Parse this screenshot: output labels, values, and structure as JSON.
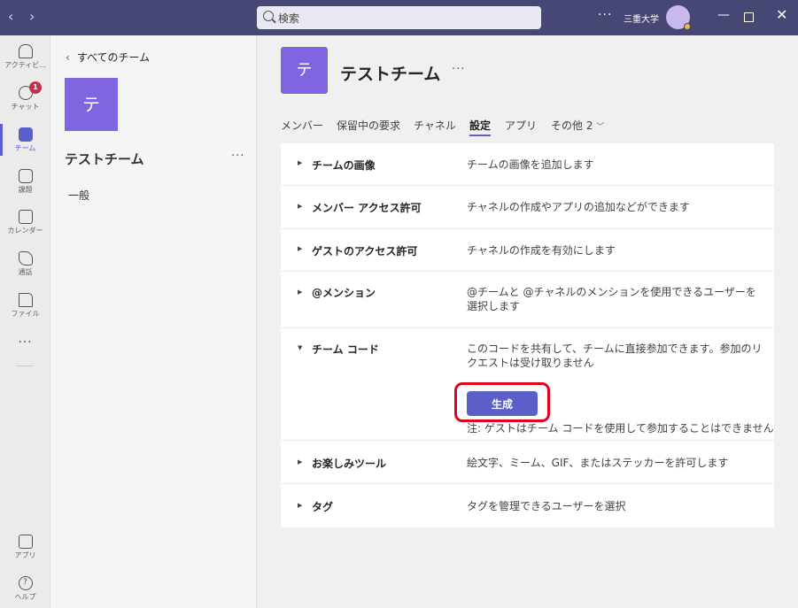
{
  "titlebar": {
    "search_placeholder": "検索",
    "more": "···",
    "org_name": "三重大学"
  },
  "rail": {
    "items": [
      {
        "label": "アクティビ...",
        "icon": "bell-icon"
      },
      {
        "label": "チャット",
        "icon": "chat-icon",
        "badge": "1"
      },
      {
        "label": "チーム",
        "icon": "teams-icon",
        "active": true
      },
      {
        "label": "課題",
        "icon": "assignments-icon"
      },
      {
        "label": "カレンダー",
        "icon": "calendar-icon"
      },
      {
        "label": "通話",
        "icon": "phone-icon"
      },
      {
        "label": "ファイル",
        "icon": "file-icon"
      },
      {
        "label": "アプリ",
        "icon": "apps-icon"
      },
      {
        "label": "ヘルプ",
        "icon": "help-icon"
      }
    ],
    "more": "···"
  },
  "sidebar": {
    "back_label": "すべてのチーム",
    "team_avatar": "テ",
    "team_name": "テストチーム",
    "more": "···",
    "channels": [
      "一般"
    ]
  },
  "main": {
    "team_avatar": "テ",
    "team_name": "テストチーム",
    "more": "···",
    "tabs": [
      "メンバー",
      "保留中の要求",
      "チャネル",
      "設定",
      "アプリ",
      "その他 2"
    ],
    "active_tab": "設定",
    "settings": [
      {
        "label": "チームの画像",
        "desc": "チームの画像を追加します",
        "expanded": false
      },
      {
        "label": "メンバー アクセス許可",
        "desc": "チャネルの作成やアプリの追加などができます",
        "expanded": false
      },
      {
        "label": "ゲストのアクセス許可",
        "desc": "チャネルの作成を有効にします",
        "expanded": false
      },
      {
        "label": "@メンション",
        "desc": "@チームと @チャネルのメンションを使用できるユーザーを選択します",
        "expanded": false
      },
      {
        "label": "チーム コード",
        "desc": "このコードを共有して、チームに直接参加できます。参加のリクエストは受け取りません",
        "expanded": true
      },
      {
        "label": "お楽しみツール",
        "desc": "絵文字、ミーム、GIF、またはステッカーを許可します",
        "expanded": false
      },
      {
        "label": "タグ",
        "desc": "タグを管理できるユーザーを選択",
        "expanded": false
      }
    ],
    "generate_button": "生成",
    "team_code_note": "注: ゲストはチーム コードを使用して参加することはできません"
  },
  "colors": {
    "titlebar": "#464775",
    "accent": "#5b5fc7",
    "avatar": "#7f65e0",
    "highlight": "#e5001a",
    "badge": "#c4314b"
  }
}
